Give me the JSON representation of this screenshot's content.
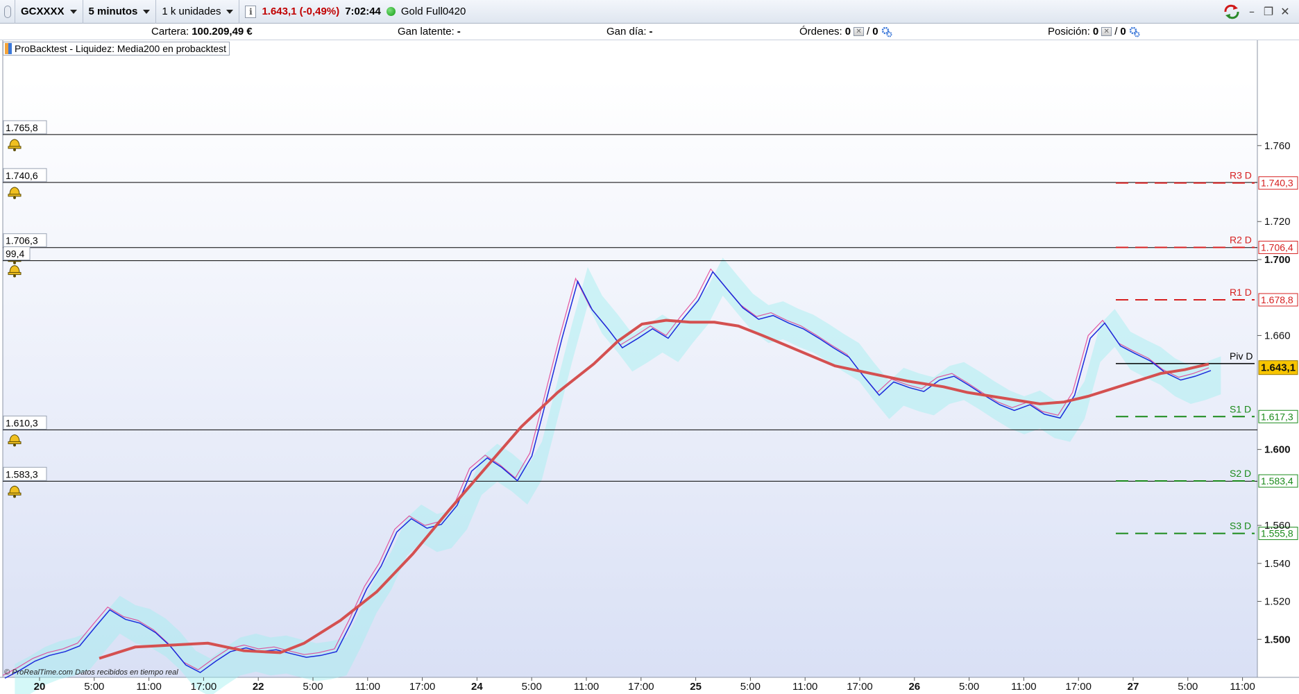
{
  "toolbar": {
    "symbol": "GCXXXX",
    "timeframe": "5 minutos",
    "units": "1 k unidades",
    "price_change": "1.643,1 (-0,49%)",
    "time": "7:02:44",
    "instrument": "Gold Full0420",
    "status_color": "#129b12"
  },
  "account": {
    "cartera_label": "Cartera:",
    "cartera_value": "100.209,49 €",
    "gan_latente_label": "Gan latente:",
    "gan_latente_value": "-",
    "gan_dia_label": "Gan día:",
    "gan_dia_value": "-",
    "ordenes_label": "Órdenes:",
    "ordenes_value": "0",
    "ordenes_sep": "/",
    "ordenes_value2": "0",
    "posicion_label": "Posición:",
    "posicion_value": "0",
    "posicion_sep": "/",
    "posicion_value2": "0"
  },
  "indicator_label": "ProBacktest - Liquidez: Media200 en probacktest",
  "footer": {
    "brand": "© ProRealTime.com",
    "note": "Datos recibidos en tiempo real"
  },
  "chart_data": {
    "type": "line",
    "instrument": "GCXXXX",
    "ylim": [
      1480,
      1795
    ],
    "y_ticks": [
      {
        "value": 1760,
        "label": "1.760",
        "bold": false
      },
      {
        "value": 1720,
        "label": "1.720",
        "bold": false
      },
      {
        "value": 1700,
        "label": "1.700",
        "bold": true
      },
      {
        "value": 1660,
        "label": "1.660",
        "bold": false
      },
      {
        "value": 1600,
        "label": "1.600",
        "bold": true
      },
      {
        "value": 1560,
        "label": "1.560",
        "bold": false
      },
      {
        "value": 1540,
        "label": "1.540",
        "bold": false
      },
      {
        "value": 1520,
        "label": "1.520",
        "bold": false
      },
      {
        "value": 1500,
        "label": "1.500",
        "bold": true
      }
    ],
    "x_ticks": [
      {
        "label": "20",
        "day": true
      },
      {
        "label": "5:00",
        "day": false
      },
      {
        "label": "11:00",
        "day": false
      },
      {
        "label": "17:00",
        "day": false
      },
      {
        "label": "22",
        "day": true
      },
      {
        "label": "5:00",
        "day": false
      },
      {
        "label": "11:00",
        "day": false
      },
      {
        "label": "17:00",
        "day": false
      },
      {
        "label": "24",
        "day": true
      },
      {
        "label": "5:00",
        "day": false
      },
      {
        "label": "11:00",
        "day": false
      },
      {
        "label": "17:00",
        "day": false
      },
      {
        "label": "25",
        "day": true
      },
      {
        "label": "5:00",
        "day": false
      },
      {
        "label": "11:00",
        "day": false
      },
      {
        "label": "17:00",
        "day": false
      },
      {
        "label": "26",
        "day": true
      },
      {
        "label": "5:00",
        "day": false
      },
      {
        "label": "11:00",
        "day": false
      },
      {
        "label": "17:00",
        "day": false
      },
      {
        "label": "27",
        "day": true
      },
      {
        "label": "5:00",
        "day": false
      },
      {
        "label": "11:00",
        "day": false
      }
    ],
    "alert_lines": [
      {
        "value": 1765.8,
        "label": "1.765,8"
      },
      {
        "value": 1740.6,
        "label": "1.740,6"
      },
      {
        "value": 1706.3,
        "label": "1.706,3"
      },
      {
        "value": 1699.4,
        "label": "99,4"
      },
      {
        "value": 1610.3,
        "label": "1.610,3"
      },
      {
        "value": 1583.3,
        "label": "1.583,3"
      }
    ],
    "pivots": [
      {
        "name": "R3 D",
        "value": 1740.3,
        "label": "1.740,3",
        "color": "#d62020"
      },
      {
        "name": "R2 D",
        "value": 1706.4,
        "label": "1.706,4",
        "color": "#d62020"
      },
      {
        "name": "R1 D",
        "value": 1678.8,
        "label": "1.678,8",
        "color": "#d62020"
      },
      {
        "name": "Piv D",
        "value": 1645.2,
        "label": "",
        "color": "#000000"
      },
      {
        "name": "S1 D",
        "value": 1617.3,
        "label": "1.617,3",
        "color": "#1a8a1a"
      },
      {
        "name": "S2 D",
        "value": 1583.4,
        "label": "1.583,4",
        "color": "#1a8a1a"
      },
      {
        "name": "S3 D",
        "value": 1555.8,
        "label": "1.555,8",
        "color": "#1a8a1a"
      }
    ],
    "last_price": {
      "value": 1643.1,
      "label": "1.643,1"
    },
    "series": [
      {
        "name": "price",
        "color": "#7a3fb0",
        "x": [
          0.0,
          0.012,
          0.025,
          0.037,
          0.05,
          0.062,
          0.075,
          0.087,
          0.1,
          0.112,
          0.125,
          0.137,
          0.15,
          0.162,
          0.175,
          0.187,
          0.2,
          0.212,
          0.225,
          0.237,
          0.25,
          0.262,
          0.275,
          0.287,
          0.3,
          0.312,
          0.325,
          0.337,
          0.35,
          0.362,
          0.375,
          0.387,
          0.4,
          0.412,
          0.425,
          0.437,
          0.45,
          0.462,
          0.475,
          0.487,
          0.5,
          0.512,
          0.525,
          0.537,
          0.55,
          0.562,
          0.575,
          0.587,
          0.6,
          0.612,
          0.625,
          0.637,
          0.65,
          0.662,
          0.675,
          0.687,
          0.7,
          0.712,
          0.725,
          0.737,
          0.75,
          0.762,
          0.775,
          0.787,
          0.8,
          0.812,
          0.825,
          0.837,
          0.85,
          0.862,
          0.875,
          0.887,
          0.9,
          0.912,
          0.925,
          0.937,
          0.95,
          0.962,
          0.975,
          0.987,
          1.0
        ],
        "y": [
          1481,
          1485,
          1490,
          1493,
          1495,
          1498,
          1508,
          1517,
          1512,
          1510,
          1505,
          1498,
          1488,
          1484,
          1490,
          1495,
          1497,
          1495,
          1496,
          1494,
          1492,
          1493,
          1495,
          1510,
          1528,
          1540,
          1558,
          1565,
          1560,
          1562,
          1572,
          1590,
          1597,
          1592,
          1585,
          1598,
          1630,
          1660,
          1690,
          1675,
          1665,
          1655,
          1660,
          1665,
          1660,
          1670,
          1680,
          1695,
          1685,
          1676,
          1670,
          1672,
          1668,
          1665,
          1660,
          1655,
          1650,
          1640,
          1630,
          1637,
          1634,
          1632,
          1638,
          1640,
          1635,
          1630,
          1625,
          1622,
          1625,
          1620,
          1618,
          1630,
          1660,
          1668,
          1656,
          1652,
          1648,
          1642,
          1638,
          1640,
          1643
        ]
      },
      {
        "name": "Media200",
        "color": "#d45050",
        "x": [
          0.08,
          0.11,
          0.14,
          0.17,
          0.2,
          0.23,
          0.25,
          0.28,
          0.31,
          0.34,
          0.37,
          0.4,
          0.43,
          0.46,
          0.49,
          0.51,
          0.53,
          0.55,
          0.57,
          0.59,
          0.61,
          0.63,
          0.66,
          0.69,
          0.72,
          0.75,
          0.78,
          0.8,
          0.82,
          0.84,
          0.86,
          0.88,
          0.9,
          0.92,
          0.94,
          0.96,
          0.98,
          1.0
        ],
        "y": [
          1490,
          1496,
          1497,
          1498,
          1494,
          1493,
          1498,
          1510,
          1525,
          1545,
          1568,
          1590,
          1612,
          1630,
          1645,
          1657,
          1666,
          1668,
          1667,
          1667,
          1665,
          1660,
          1652,
          1644,
          1640,
          1636,
          1633,
          1630,
          1628,
          1626,
          1624,
          1625,
          1628,
          1632,
          1636,
          1640,
          1642,
          1645
        ]
      }
    ]
  }
}
